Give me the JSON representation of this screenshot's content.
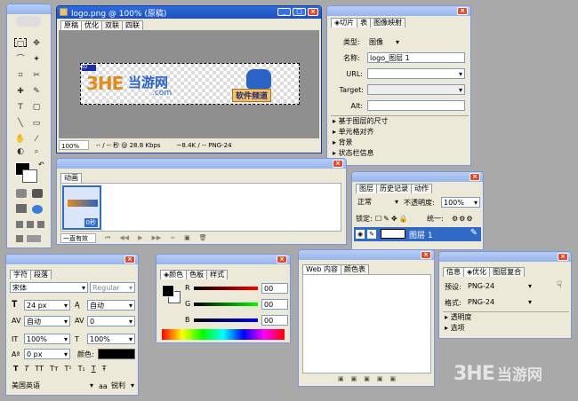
{
  "doc": {
    "title": "logo.png @ 100% (原稿)",
    "tabs": [
      "原稿",
      "优化",
      "双联",
      "四联"
    ],
    "status": {
      "zoom": "100%",
      "speed": "-- / -- 秒 @ 28.8 Kbps",
      "size": "~8.4K / -- PNG-24"
    },
    "logo": {
      "tag": "3HE",
      "main": "当游网",
      "sub": ".com",
      "badge": "软件频道"
    }
  },
  "slice": {
    "tabs": [
      "切片",
      "表",
      "图像映射"
    ],
    "type_label": "类型:",
    "type_value": "图像",
    "name_label": "名称:",
    "name_value": "logo_图层 1",
    "url_label": "URL:",
    "target_label": "Target:",
    "alt_label": "Alt:",
    "sections": [
      "基于图层的尺寸",
      "单元格对齐",
      "背景",
      "状态栏信息"
    ]
  },
  "anim": {
    "tab": "动画",
    "frame_label": "0秒",
    "loop": "一直有效"
  },
  "layers": {
    "tabs": [
      "图层",
      "历史记录",
      "动作"
    ],
    "blend": "正常",
    "opacity_label": "不透明度:",
    "opacity": "100%",
    "lock_label": "锁定:",
    "unify_label": "统一:",
    "layer_name": "图层 1"
  },
  "char": {
    "tabs": [
      "字符",
      "段落"
    ],
    "font": "宋体",
    "style": "Regular",
    "size": "24 px",
    "leading": "自动",
    "tracking": "自动",
    "kern": "0",
    "vscale": "100%",
    "hscale": "100%",
    "baseline": "0 px",
    "color_label": "颜色:",
    "lang": "美国英语",
    "aa_label": "aa",
    "aa": "锐利",
    "styles": [
      "T",
      "T",
      "TT",
      "Tт",
      "T¹",
      "T₁",
      "T",
      "Ŧ"
    ]
  },
  "color": {
    "tabs": [
      "颜色",
      "色板",
      "样式"
    ],
    "r": "R",
    "g": "G",
    "b": "B",
    "r_val": "00",
    "g_val": "00",
    "b_val": "00"
  },
  "web": {
    "tabs": [
      "Web 内容",
      "颜色表"
    ]
  },
  "info": {
    "tabs": [
      "信息",
      "优化",
      "图层复合"
    ],
    "preset_label": "预设:",
    "preset": "PNG-24",
    "format_label": "格式:",
    "format": "PNG-24",
    "sections": [
      "透明度",
      "选项"
    ]
  },
  "watermark": {
    "mark": "3HE",
    "text": "当游网"
  },
  "colors": {
    "title_grad": "#96b5ec",
    "panel": "#ece9d8",
    "accent": "#316ac5"
  }
}
